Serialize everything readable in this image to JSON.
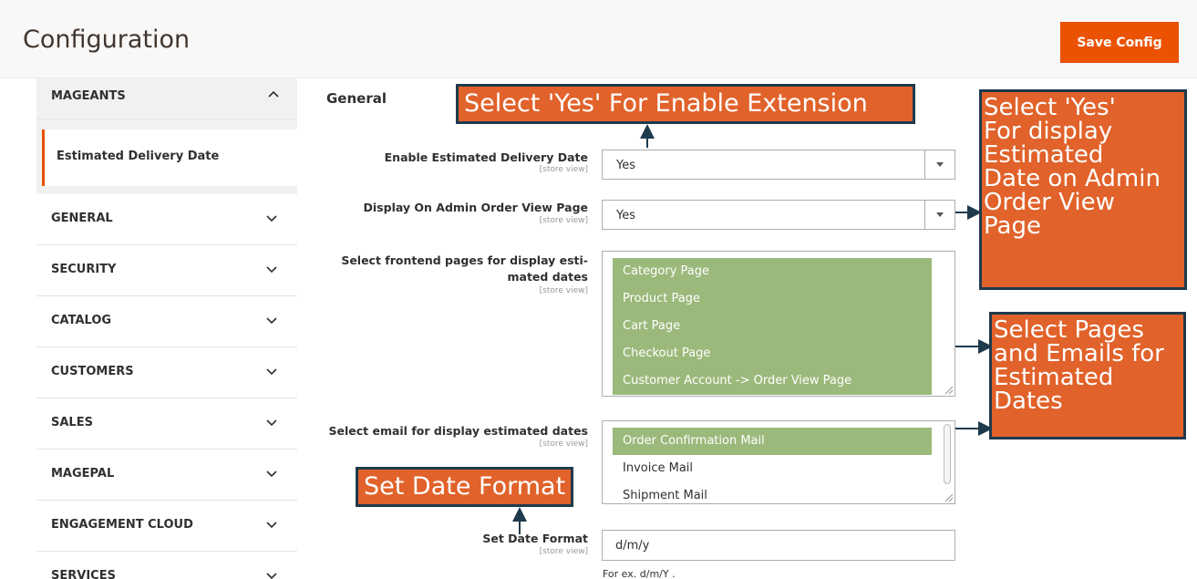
{
  "header": {
    "title": "Configuration",
    "save_label": "Save Config",
    "accent_color": "#eb5202"
  },
  "sidebar": {
    "section": {
      "label": "MAGEANTS",
      "icon": "chevron-up-icon"
    },
    "active_item": {
      "label": "Estimated Delivery Date"
    },
    "items": [
      {
        "label": "GENERAL",
        "icon": "chevron-down-icon"
      },
      {
        "label": "SECURITY",
        "icon": "chevron-down-icon"
      },
      {
        "label": "CATALOG",
        "icon": "chevron-down-icon"
      },
      {
        "label": "CUSTOMERS",
        "icon": "chevron-down-icon"
      },
      {
        "label": "SALES",
        "icon": "chevron-down-icon"
      },
      {
        "label": "MAGEPAL",
        "icon": "chevron-down-icon"
      },
      {
        "label": "ENGAGEMENT CLOUD",
        "icon": "chevron-down-icon"
      },
      {
        "label": "SERVICES",
        "icon": "chevron-down-icon"
      }
    ]
  },
  "main": {
    "section_title": "General",
    "fields": {
      "enable": {
        "label": "Enable Estimated Delivery Date",
        "scope": "[store view]",
        "value": "Yes"
      },
      "admin_view": {
        "label": "Display On Admin Order View Page",
        "scope": "[store view]",
        "value": "Yes"
      },
      "frontend_pages": {
        "label_line1": "Select frontend pages for display esti-",
        "label_line2": "mated dates",
        "scope": "[store view]",
        "options": [
          {
            "label": "Category Page",
            "selected": true
          },
          {
            "label": "Product Page",
            "selected": true
          },
          {
            "label": "Cart Page",
            "selected": true
          },
          {
            "label": "Checkout Page",
            "selected": true
          },
          {
            "label": "Customer Account -> Order View Page",
            "selected": true
          }
        ]
      },
      "emails": {
        "label": "Select email for display estimated dates",
        "scope": "[store view]",
        "options": [
          {
            "label": "Order Confirmation Mail",
            "selected": true
          },
          {
            "label": "Invoice Mail",
            "selected": false
          },
          {
            "label": "Shipment Mail",
            "selected": false
          }
        ]
      },
      "date_format": {
        "label": "Set Date Format",
        "scope": "[store view]",
        "value": "d/m/y",
        "note": "For ex. d/m/Y ."
      }
    },
    "selected_color": "#9bb97b"
  },
  "annotations": {
    "enable": "Select 'Yes' For Enable Extension",
    "admin": "Select 'Yes'\nFor display\nEstimated\nDate on Admin\nOrder View\nPage",
    "pages": "Select Pages\nand Emails for\nEstimated\nDates",
    "date": "Set Date Format",
    "callout_color": "#e1622a",
    "border_color": "#1f3a4d"
  }
}
